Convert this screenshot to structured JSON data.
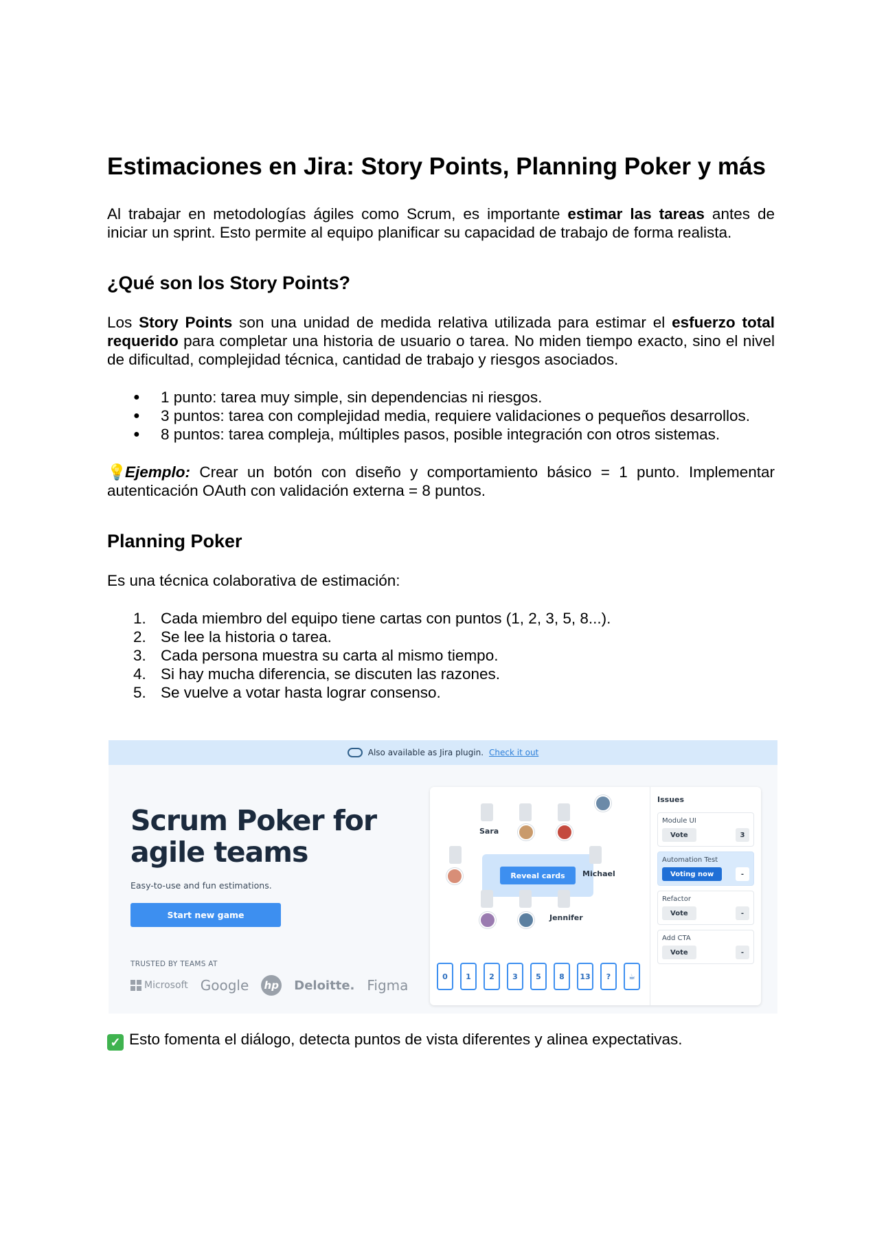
{
  "doc": {
    "title": "Estimaciones en Jira: Story Points, Planning Poker y más",
    "intro": {
      "pre": "Al trabajar en metodologías ágiles como Scrum, es importante ",
      "bold": "estimar las tareas",
      "post": " antes de iniciar un sprint. Esto permite al equipo planificar su capacidad de trabajo de forma realista."
    },
    "section1": {
      "heading": "¿Qué son los Story Points?",
      "p_pre": "Los ",
      "p_bold1": "Story Points",
      "p_mid": " son una unidad de medida relativa utilizada para estimar el ",
      "p_bold2": "esfuerzo total requerido",
      "p_post": " para completar una historia de usuario o tarea. No miden tiempo exacto, sino el nivel de dificultad, complejidad técnica, cantidad de trabajo y riesgos asociados.",
      "bullet_marker": "●",
      "bullets": [
        "1 punto: tarea muy simple, sin dependencias ni riesgos.",
        "3 puntos: tarea con complejidad media, requiere validaciones o pequeños desarrollos.",
        "8 puntos: tarea compleja, múltiples pasos, posible integración con otros sistemas."
      ],
      "example_icon": "lightbulb-icon",
      "example_label": "Ejemplo:",
      "example_text": " Crear un botón con diseño y comportamiento básico = 1 punto. Implementar autenticación OAuth con validación externa = 8 puntos."
    },
    "section2": {
      "heading": "Planning Poker",
      "intro": "Es una técnica colaborativa de estimación:",
      "steps": [
        "Cada miembro del equipo tiene cartas con puntos (1, 2, 3, 5, 8...).",
        "Se lee la historia o tarea.",
        "Cada persona muestra su carta al mismo tiempo.",
        "Si hay mucha diferencia, se discuten las razones.",
        "Se vuelve a votar hasta lograr consenso."
      ]
    },
    "closing_icon": "check-mark-icon",
    "closing": "Esto fomenta el diálogo, detecta puntos de vista diferentes y alinea expectativas."
  },
  "screenshot": {
    "banner_text": "Also available as Jira plugin.",
    "banner_link": "Check it out",
    "hero_title_line1": "Scrum Poker for",
    "hero_title_line2": "agile teams",
    "hero_sub": "Easy-to-use and fun estimations.",
    "start_button": "Start new game",
    "trusted": "TRUSTED BY TEAMS AT",
    "logos": [
      "Microsoft",
      "Google",
      "hp",
      "Deloitte.",
      "Figma"
    ],
    "players": [
      "Sara",
      "Michael",
      "Jennifer"
    ],
    "reveal_button": "Reveal cards",
    "cards": [
      "0",
      "1",
      "2",
      "3",
      "5",
      "8",
      "13",
      "?",
      "☕"
    ],
    "issues_title": "Issues",
    "issues": [
      {
        "name": "Module UI",
        "button": "Vote",
        "points": "3"
      },
      {
        "name": "Automation Test",
        "button": "Voting now",
        "points": "-"
      },
      {
        "name": "Refactor",
        "button": "Vote",
        "points": "-"
      },
      {
        "name": "Add CTA",
        "button": "Vote",
        "points": "-"
      }
    ],
    "colors": {
      "accent": "#3d8ff0",
      "banner": "#d7e9fb",
      "active_issue": "#d9eafc"
    }
  }
}
